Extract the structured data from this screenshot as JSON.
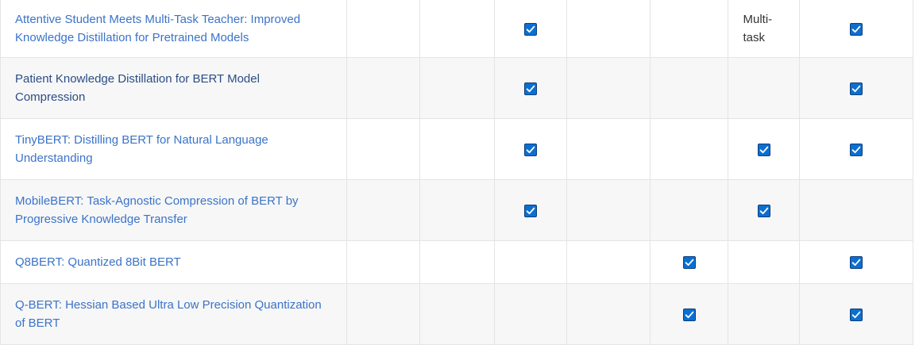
{
  "colors": {
    "link": "#3b73c8",
    "link_visited": "#2a4d86",
    "checkbox_fill": "#0b6fd1",
    "checkbox_border": "#0f3d7a",
    "row_alt": "#f7f7f7",
    "grid": "#e4e4e4"
  },
  "table": {
    "rows": [
      {
        "title": "Attentive Student Meets Multi-Task Teacher: Improved Knowledge Distillation for Pretrained Models",
        "visited": false,
        "cells": [
          {
            "type": "empty"
          },
          {
            "type": "empty"
          },
          {
            "type": "check",
            "checked": true
          },
          {
            "type": "empty"
          },
          {
            "type": "empty"
          },
          {
            "type": "text",
            "value": "Multi-task"
          },
          {
            "type": "check",
            "checked": true
          }
        ]
      },
      {
        "title": "Patient Knowledge Distillation for BERT Model Compression",
        "visited": true,
        "cells": [
          {
            "type": "empty"
          },
          {
            "type": "empty"
          },
          {
            "type": "check",
            "checked": true
          },
          {
            "type": "empty"
          },
          {
            "type": "empty"
          },
          {
            "type": "empty"
          },
          {
            "type": "check",
            "checked": true
          }
        ]
      },
      {
        "title": "TinyBERT: Distilling BERT for Natural Language Understanding",
        "visited": false,
        "cells": [
          {
            "type": "empty"
          },
          {
            "type": "empty"
          },
          {
            "type": "check",
            "checked": true
          },
          {
            "type": "empty"
          },
          {
            "type": "empty"
          },
          {
            "type": "check",
            "checked": true
          },
          {
            "type": "check",
            "checked": true
          }
        ]
      },
      {
        "title": "MobileBERT: Task-Agnostic Compression of BERT by Progressive Knowledge Transfer",
        "visited": false,
        "cells": [
          {
            "type": "empty"
          },
          {
            "type": "empty"
          },
          {
            "type": "check",
            "checked": true
          },
          {
            "type": "empty"
          },
          {
            "type": "empty"
          },
          {
            "type": "check",
            "checked": true
          },
          {
            "type": "empty"
          }
        ]
      },
      {
        "title": "Q8BERT: Quantized 8Bit BERT",
        "visited": false,
        "cells": [
          {
            "type": "empty"
          },
          {
            "type": "empty"
          },
          {
            "type": "empty"
          },
          {
            "type": "empty"
          },
          {
            "type": "check",
            "checked": true
          },
          {
            "type": "empty"
          },
          {
            "type": "check",
            "checked": true
          }
        ]
      },
      {
        "title": "Q-BERT: Hessian Based Ultra Low Precision Quantization of BERT",
        "visited": false,
        "cells": [
          {
            "type": "empty"
          },
          {
            "type": "empty"
          },
          {
            "type": "empty"
          },
          {
            "type": "empty"
          },
          {
            "type": "check",
            "checked": true
          },
          {
            "type": "empty"
          },
          {
            "type": "check",
            "checked": true
          }
        ]
      }
    ]
  }
}
